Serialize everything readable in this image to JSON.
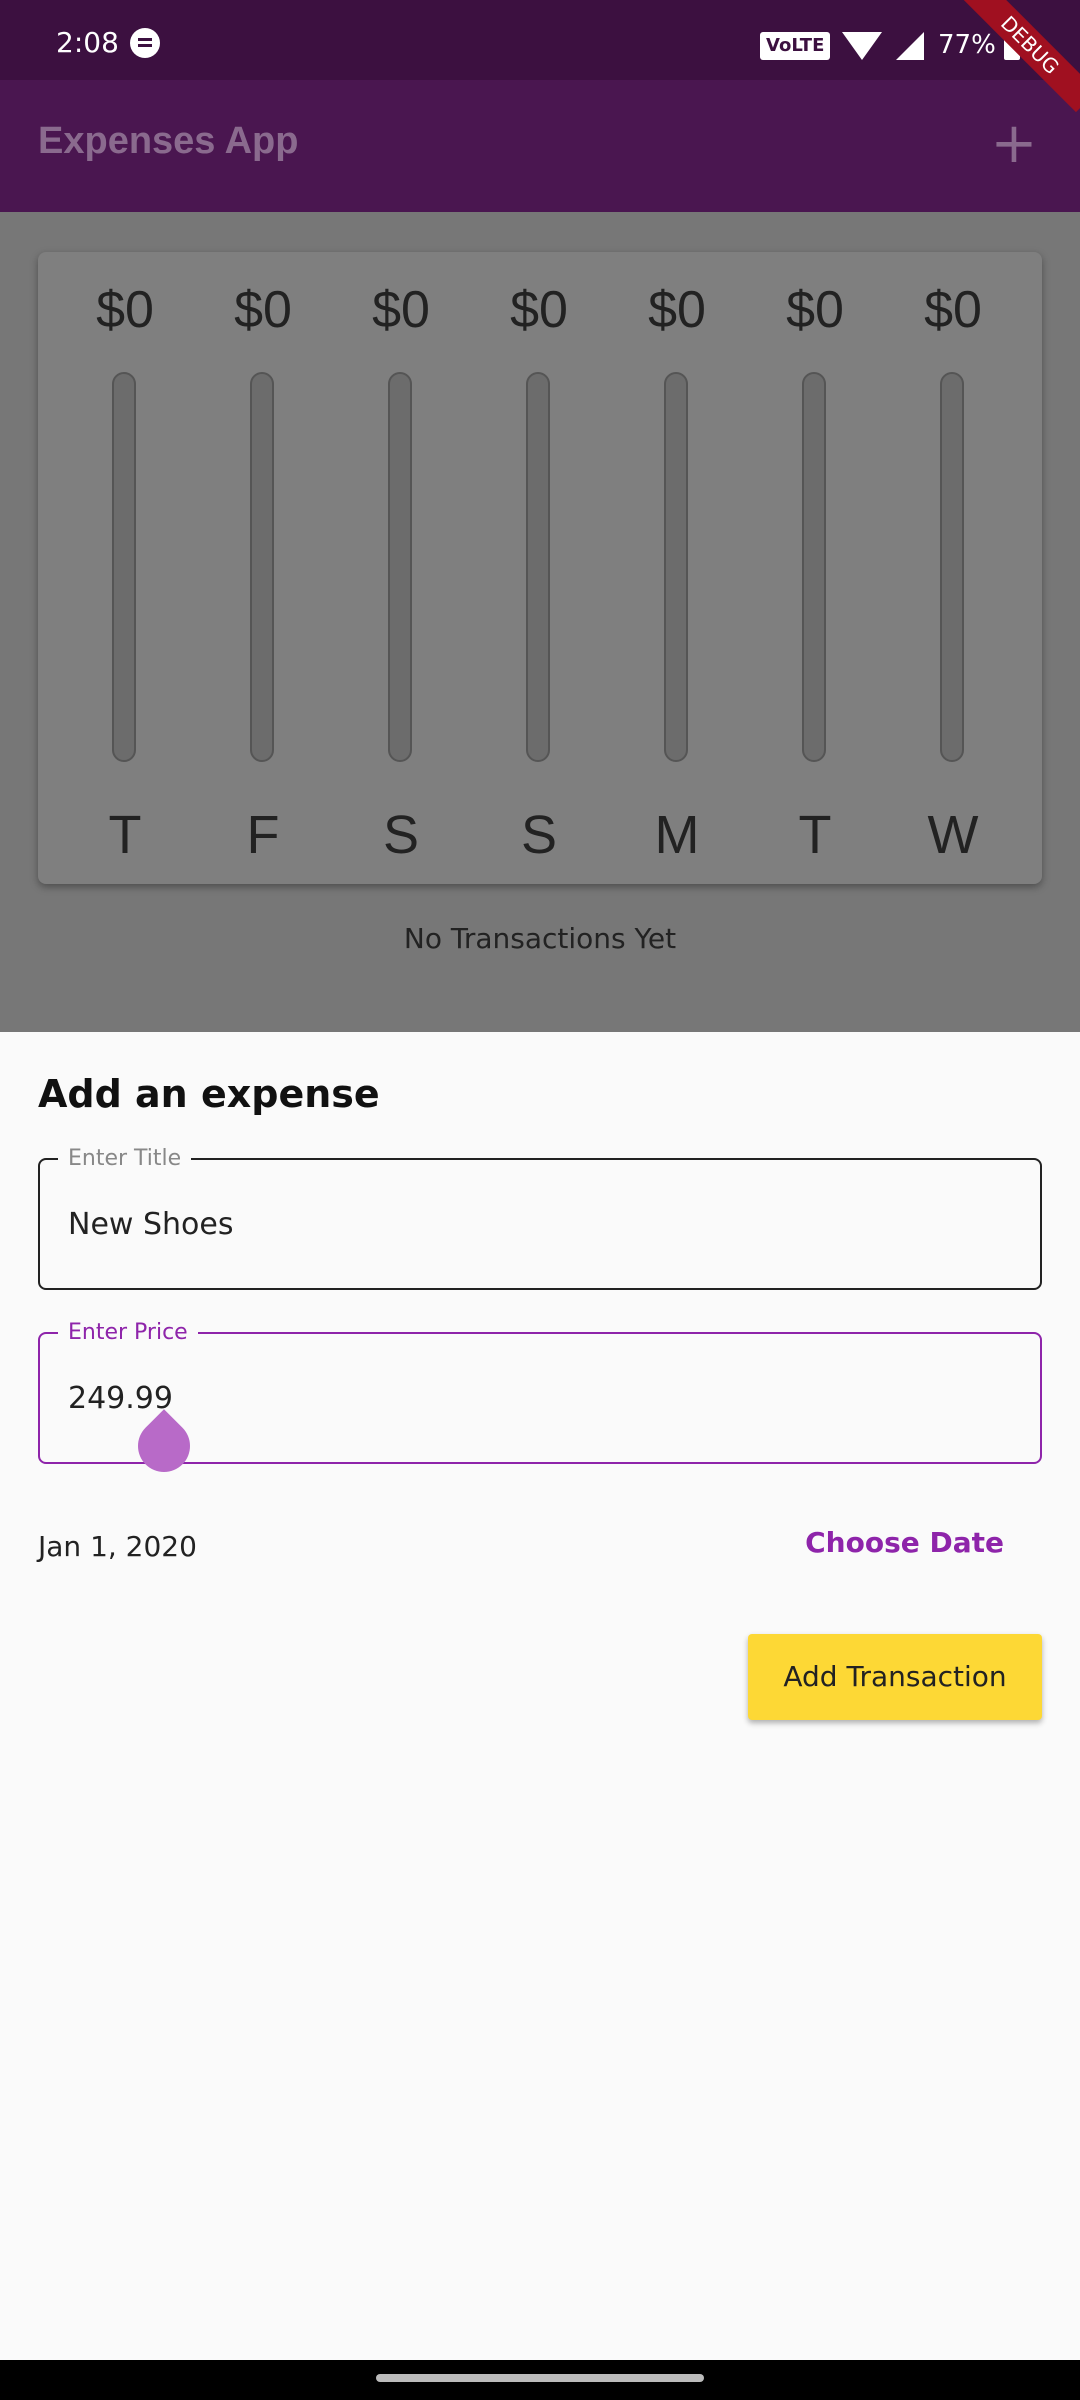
{
  "status_bar": {
    "time": "2:08",
    "volte": "VoLTE",
    "battery": "77%",
    "icons": [
      "message-icon",
      "wifi-icon",
      "signal-icon",
      "battery-icon"
    ]
  },
  "debug_banner": "DEBUG",
  "app_bar": {
    "title": "Expenses App",
    "add_icon": "+"
  },
  "chart": {
    "bars": [
      {
        "amount": "$0",
        "day": "T",
        "fill_fraction": 0
      },
      {
        "amount": "$0",
        "day": "F",
        "fill_fraction": 0
      },
      {
        "amount": "$0",
        "day": "S",
        "fill_fraction": 0
      },
      {
        "amount": "$0",
        "day": "S",
        "fill_fraction": 0
      },
      {
        "amount": "$0",
        "day": "M",
        "fill_fraction": 0
      },
      {
        "amount": "$0",
        "day": "T",
        "fill_fraction": 0
      },
      {
        "amount": "$0",
        "day": "W",
        "fill_fraction": 0
      }
    ]
  },
  "empty_state": "No Transactions Yet",
  "sheet": {
    "heading": "Add an expense",
    "title_field": {
      "label": "Enter Title",
      "value": "New Shoes"
    },
    "price_field": {
      "label": "Enter Price",
      "value": "249.99"
    },
    "date": "Jan 1, 2020",
    "choose_date_label": "Choose Date",
    "add_button_label": "Add Transaction"
  },
  "colors": {
    "accent": "#8e24aa",
    "app_bar": "#4a1650",
    "button": "#fdd835"
  }
}
